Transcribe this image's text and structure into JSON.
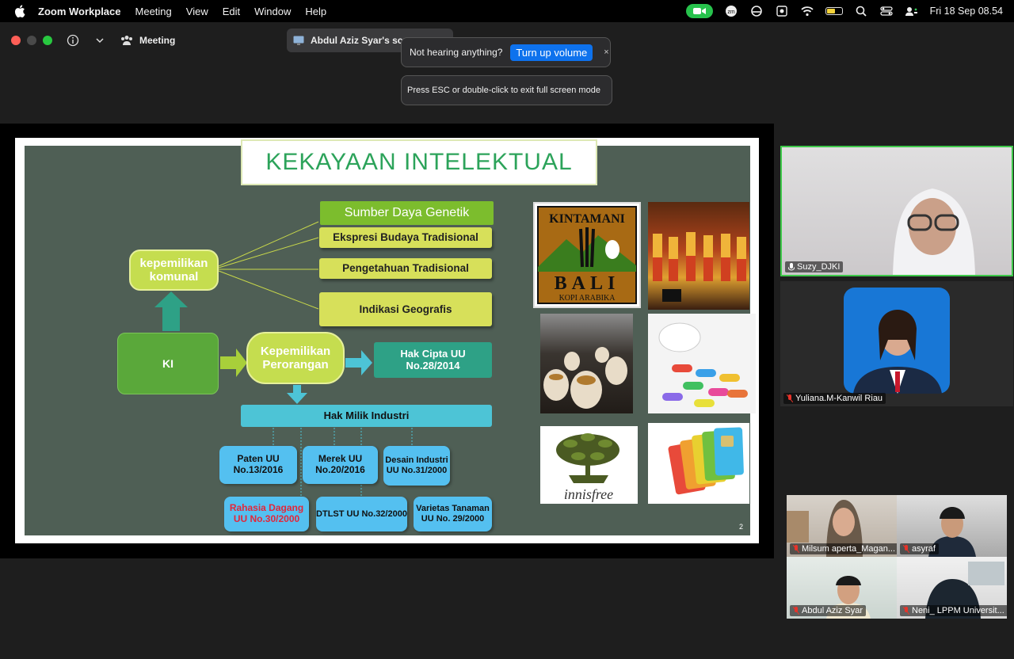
{
  "menubar": {
    "app_name": "Zoom Workplace",
    "menus": [
      "Meeting",
      "View",
      "Edit",
      "Window",
      "Help"
    ],
    "clock": "Fri 18 Sep  08.54"
  },
  "titlebar": {
    "meeting_label": "Meeting"
  },
  "share_indicator": "Abdul Aziz Syar's screen",
  "volume_popup": {
    "text": "Not hearing anything?",
    "button": "Turn up volume",
    "close": "×"
  },
  "esc_popup": {
    "text": "Press ESC or double-click to exit full screen mode"
  },
  "slide": {
    "title": "KEKAYAAN INTELEKTUAL",
    "communal_items": [
      "Sumber Daya Genetik",
      "Ekspresi  Budaya Tradisional",
      "Pengetahuan Tradisional",
      "Indikasi Geografis"
    ],
    "kepemilikan_komunal": "kepemilikan komunal",
    "ki": "KI",
    "kepemilikan_perorangan": "Kepemilikan Perorangan",
    "hak_cipta": "Hak Cipta UU No.28/2014",
    "hak_milik_industri": "Hak Milik Industri",
    "paten": "Paten UU No.13/2016",
    "merek": "Merek UU No.20/2016",
    "desain": "Desain Industri UU No.31/2000",
    "rahasia": "Rahasia Dagang UU No.30/2000",
    "dtlst": "DTLST UU No.32/2000",
    "varietas": "Varietas Tanaman UU No. 29/2000",
    "page_number": "2",
    "logo_kintamani": {
      "top": "KINTAMANI",
      "mid": "BALI",
      "bottom": "KOPI ARABIKA"
    },
    "logo_innisfree": "innisfree"
  },
  "participants": [
    {
      "name": "Suzy_DJKI",
      "active": true
    },
    {
      "name": "Yuliana.M-Kanwil Riau"
    },
    {
      "name": "Milsum aperta_Magan..."
    },
    {
      "name": "asyraf"
    },
    {
      "name": "Abdul Aziz Syar"
    },
    {
      "name": "Neni_ LPPM Universit..."
    }
  ],
  "colors": {
    "active_speaker_border": "#3ec84a",
    "accent_blue": "#0e72ed",
    "slide_title_green": "#2ca35a"
  }
}
